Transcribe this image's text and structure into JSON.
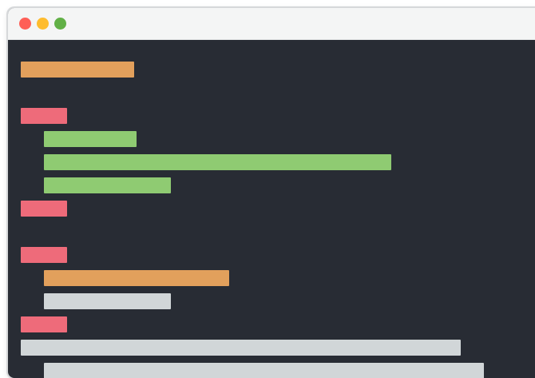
{
  "window": {
    "controls": [
      {
        "name": "close-button",
        "color": "#fe5f57"
      },
      {
        "name": "minimize-button",
        "color": "#febc2e"
      },
      {
        "name": "maximize-button",
        "color": "#61b046"
      }
    ],
    "background": "#282c34",
    "titlebar_color": "#f4f5f5"
  },
  "code_lines": [
    {
      "token": "keyword-orange",
      "color": "#e2a05c"
    },
    {
      "token": "tag-red",
      "color": "#ee6b7a"
    },
    {
      "token": "string-green",
      "color": "#8fcb72"
    },
    {
      "token": "string-green",
      "color": "#8fcb72"
    },
    {
      "token": "string-green",
      "color": "#8fcb72"
    },
    {
      "token": "tag-red",
      "color": "#ee6b7a"
    },
    {
      "token": "tag-red",
      "color": "#ee6b7a"
    },
    {
      "token": "keyword-orange",
      "color": "#e2a05c"
    },
    {
      "token": "plain-gray",
      "color": "#d1d6d8"
    },
    {
      "token": "tag-red",
      "color": "#ee6b7a"
    },
    {
      "token": "plain-gray",
      "color": "#d1d6d8"
    },
    {
      "token": "plain-gray",
      "color": "#d1d6d8"
    }
  ]
}
